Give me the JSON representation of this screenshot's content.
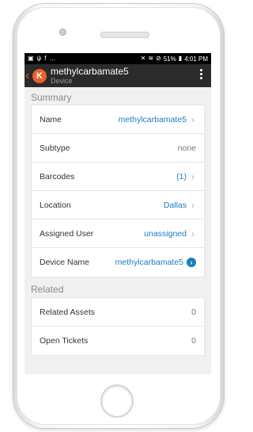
{
  "status_bar": {
    "left_icons": [
      "image-icon",
      "usb-icon",
      "facebook-icon",
      "more-dots-icon"
    ],
    "left_glyphs": [
      "▣",
      "ψ",
      "f",
      "…"
    ],
    "right_glyphs": [
      "✕",
      "≋",
      "⊘",
      "▮"
    ],
    "battery": "51%",
    "time": "4:01 PM"
  },
  "app_bar": {
    "avatar_letter": "K",
    "title": "methylcarbamate5",
    "subtitle": "Device"
  },
  "summary": {
    "header": "Summary",
    "rows": [
      {
        "label": "Name",
        "value": "methylcarbamate5"
      },
      {
        "label": "Subtype",
        "value": "none"
      },
      {
        "label": "Barcodes",
        "value": "(1)"
      },
      {
        "label": "Location",
        "value": "Dallas"
      },
      {
        "label": "Assigned User",
        "value": "unassigned"
      },
      {
        "label": "Device Name",
        "value": "methylcarbamate5"
      }
    ]
  },
  "related": {
    "header": "Related",
    "rows": [
      {
        "label": "Related Assets",
        "value": "0"
      },
      {
        "label": "Open Tickets",
        "value": "0"
      }
    ]
  },
  "colors": {
    "accent": "#1a7fc0",
    "brand": "#e8622a",
    "app_bar": "#2b2b2b"
  }
}
